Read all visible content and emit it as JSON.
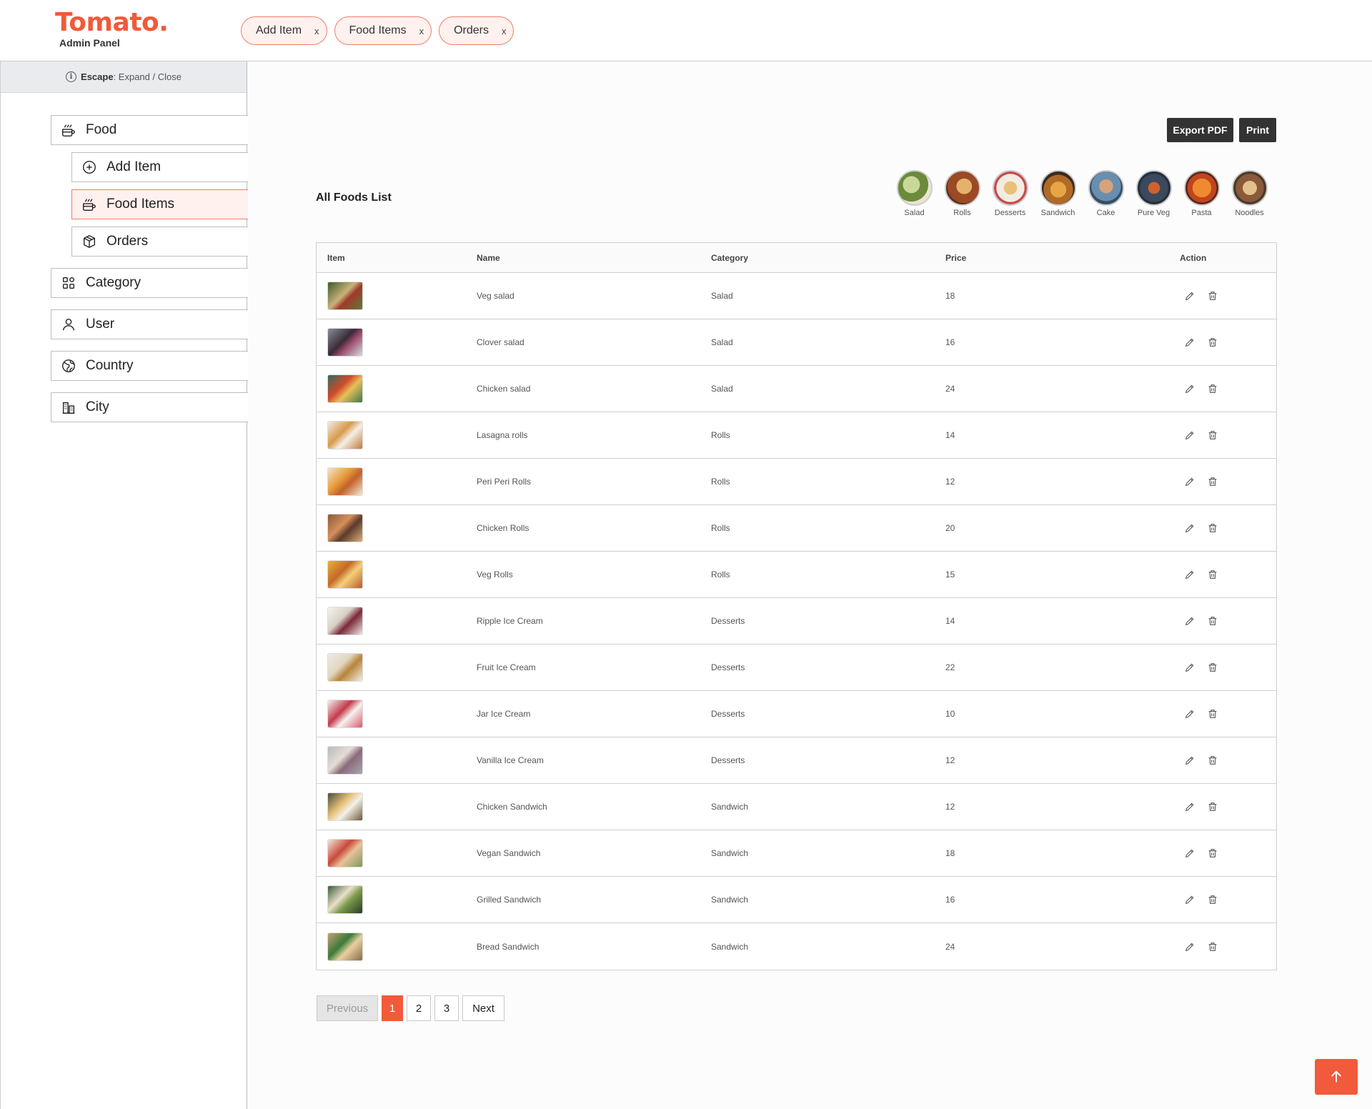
{
  "brand": {
    "title": "Tomato.",
    "subtitle": "Admin Panel"
  },
  "open_tabs": [
    {
      "label": "Add Item",
      "close": "x"
    },
    {
      "label": "Food Items",
      "close": "x"
    },
    {
      "label": "Orders",
      "close": "x"
    }
  ],
  "sidebar": {
    "hint_key": "Escape",
    "hint_text": ": Expand / Close",
    "items": [
      {
        "label": "Food",
        "icon": "food-icon"
      },
      {
        "label": "Add Item",
        "icon": "plus-circle-icon"
      },
      {
        "label": "Food Items",
        "icon": "food-icon",
        "active": true
      },
      {
        "label": "Orders",
        "icon": "box-icon"
      },
      {
        "label": "Category",
        "icon": "grid-icon"
      },
      {
        "label": "User",
        "icon": "user-icon"
      },
      {
        "label": "Country",
        "icon": "globe-icon"
      },
      {
        "label": "City",
        "icon": "city-icon"
      }
    ]
  },
  "toolbar": {
    "export_label": "Export PDF",
    "print_label": "Print"
  },
  "list": {
    "title": "All Foods List",
    "categories": [
      "Salad",
      "Rolls",
      "Desserts",
      "Sandwich",
      "Cake",
      "Pure Veg",
      "Pasta",
      "Noodles"
    ]
  },
  "table": {
    "headers": [
      "Item",
      "Name",
      "Category",
      "Price",
      "Action"
    ],
    "rows": [
      {
        "name": "Veg salad",
        "category": "Salad",
        "price": "18"
      },
      {
        "name": "Clover salad",
        "category": "Salad",
        "price": "16"
      },
      {
        "name": "Chicken salad",
        "category": "Salad",
        "price": "24"
      },
      {
        "name": "Lasagna rolls",
        "category": "Rolls",
        "price": "14"
      },
      {
        "name": "Peri Peri Rolls",
        "category": "Rolls",
        "price": "12"
      },
      {
        "name": "Chicken Rolls",
        "category": "Rolls",
        "price": "20"
      },
      {
        "name": "Veg Rolls",
        "category": "Rolls",
        "price": "15"
      },
      {
        "name": "Ripple Ice Cream",
        "category": "Desserts",
        "price": "14"
      },
      {
        "name": "Fruit Ice Cream",
        "category": "Desserts",
        "price": "22"
      },
      {
        "name": "Jar Ice Cream",
        "category": "Desserts",
        "price": "10"
      },
      {
        "name": "Vanilla Ice Cream",
        "category": "Desserts",
        "price": "12"
      },
      {
        "name": "Chicken Sandwich",
        "category": "Sandwich",
        "price": "12"
      },
      {
        "name": "Vegan Sandwich",
        "category": "Sandwich",
        "price": "18"
      },
      {
        "name": "Grilled Sandwich",
        "category": "Sandwich",
        "price": "16"
      },
      {
        "name": "Bread Sandwich",
        "category": "Sandwich",
        "price": "24"
      }
    ]
  },
  "pagination": {
    "previous": "Previous",
    "pages": [
      "1",
      "2",
      "3"
    ],
    "current": "1",
    "next": "Next"
  },
  "colors": {
    "accent": "#f15a3a",
    "tab_bg": "#fff1ee",
    "dark_button": "#333333"
  }
}
